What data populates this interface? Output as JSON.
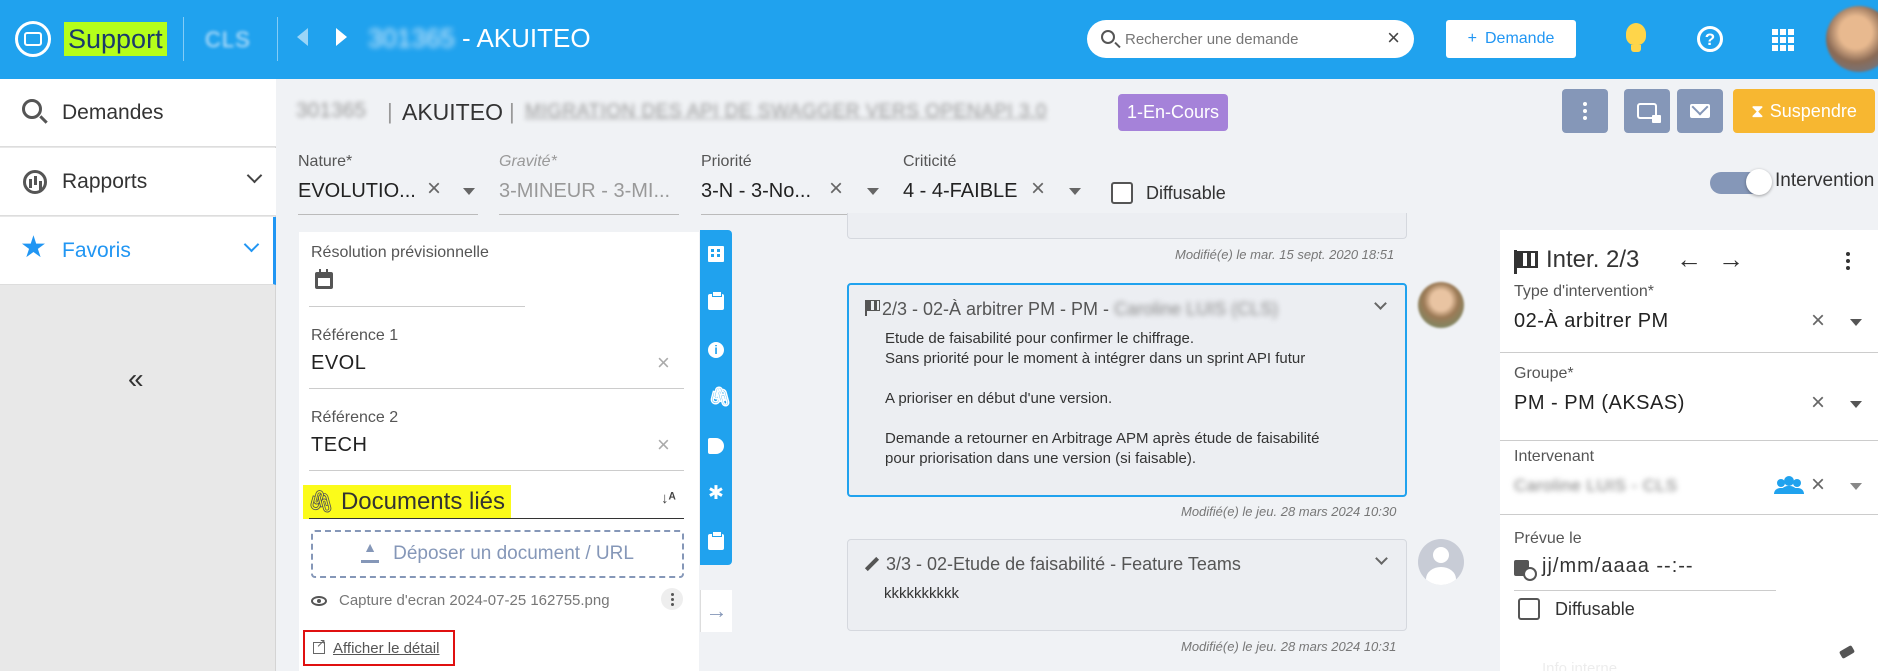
{
  "topbar": {
    "app_name": "Support",
    "org_code": "CLS",
    "ticket_id_blurred": "301365",
    "ticket_client": "- AKUITEO",
    "search_placeholder": "Rechercher une demande",
    "search_clear": "×",
    "new_button_plus": "+",
    "new_button_label": "Demande",
    "help_label": "?"
  },
  "sidebar": {
    "items": [
      {
        "label": "Demandes",
        "icon": "search-icon"
      },
      {
        "label": "Rapports",
        "icon": "chart-icon"
      },
      {
        "label": "Favoris",
        "icon": "star-icon"
      }
    ],
    "star_glyph": "★",
    "collapse_glyph": "«"
  },
  "header": {
    "ticket_id": "301365",
    "separator": "|",
    "client": "AKUITEO",
    "subject_blurred": "MIGRATION DES API DE SWAGGER VERS OPENAPI 3.0",
    "status_badge": "1-En-Cours",
    "suspend_glyph": "⧗",
    "suspend_label": "Suspendre"
  },
  "fields": {
    "nature": {
      "label": "Nature*",
      "value": "EVOLUTIO..."
    },
    "gravite": {
      "label": "Gravité*",
      "value": "3-MINEUR - 3-MI..."
    },
    "priorite": {
      "label": "Priorité",
      "value": "3-N - 3-No..."
    },
    "criticite": {
      "label": "Criticité",
      "value": "4 - 4-FAIBLE"
    },
    "diffusable_label": "Diffusable",
    "clear_glyph": "×",
    "intervention_toggle_label": "Intervention"
  },
  "left_panel": {
    "resolution_label": "Résolution prévisionnelle",
    "ref1_label": "Référence 1",
    "ref1_value": "EVOL",
    "ref2_label": "Référence 2",
    "ref2_value": "TECH",
    "clear_glyph": "×",
    "docs_title": "Documents liés",
    "clip_glyph": "🖇",
    "sort_glyph": "↓ᴬ",
    "drop_label": "Déposer un document / URL",
    "doc_name": "Capture d'ecran 2024-07-25 162755.png",
    "detail_link": "Afficher le détail"
  },
  "tool_strip": {
    "attach_glyph": "🖇",
    "asterisk_glyph": "✱",
    "arrow_glyph": "→"
  },
  "timeline": {
    "stamp_1": "Modifié(e) le mar. 15 sept. 2020 18:51",
    "card_2": {
      "prefix": "2/3 - 02-À arbitrer PM - PM - ",
      "blurred_name": "Caroline LUIS (CLS)",
      "lines": [
        "Etude de faisabilité pour confirmer le chiffrage.",
        "Sans priorité pour le moment à intégrer dans un sprint API futur",
        "",
        "A prioriser en début d'une version.",
        "",
        "Demande a retourner en Arbitrage APM après étude de faisabilité",
        "pour priorisation dans une version (si faisable)."
      ]
    },
    "stamp_2": "Modifié(e) le jeu. 28 mars 2024 10:30",
    "card_3": {
      "title": "3/3 - 02-Etude de faisabilité - Feature Teams",
      "body": "kkkkkkkkkk"
    },
    "stamp_3": "Modifié(e) le jeu. 28 mars 2024 10:31"
  },
  "right_panel": {
    "title": "Inter. 2/3",
    "prev_glyph": "←",
    "next_glyph": "→",
    "type_label": "Type d'intervention*",
    "type_value": "02-À arbitrer PM",
    "groupe_label": "Groupe*",
    "groupe_value": "PM - PM (AKSAS)",
    "intervenant_label": "Intervenant",
    "intervenant_value_blurred": "Caroline LUIS - CLS",
    "prevue_label": "Prévue le",
    "prevue_value": "jj/mm/aaaa --:--",
    "diffusable_label": "Diffusable",
    "bottom_text": "Info interne",
    "clear_glyph": "×"
  }
}
